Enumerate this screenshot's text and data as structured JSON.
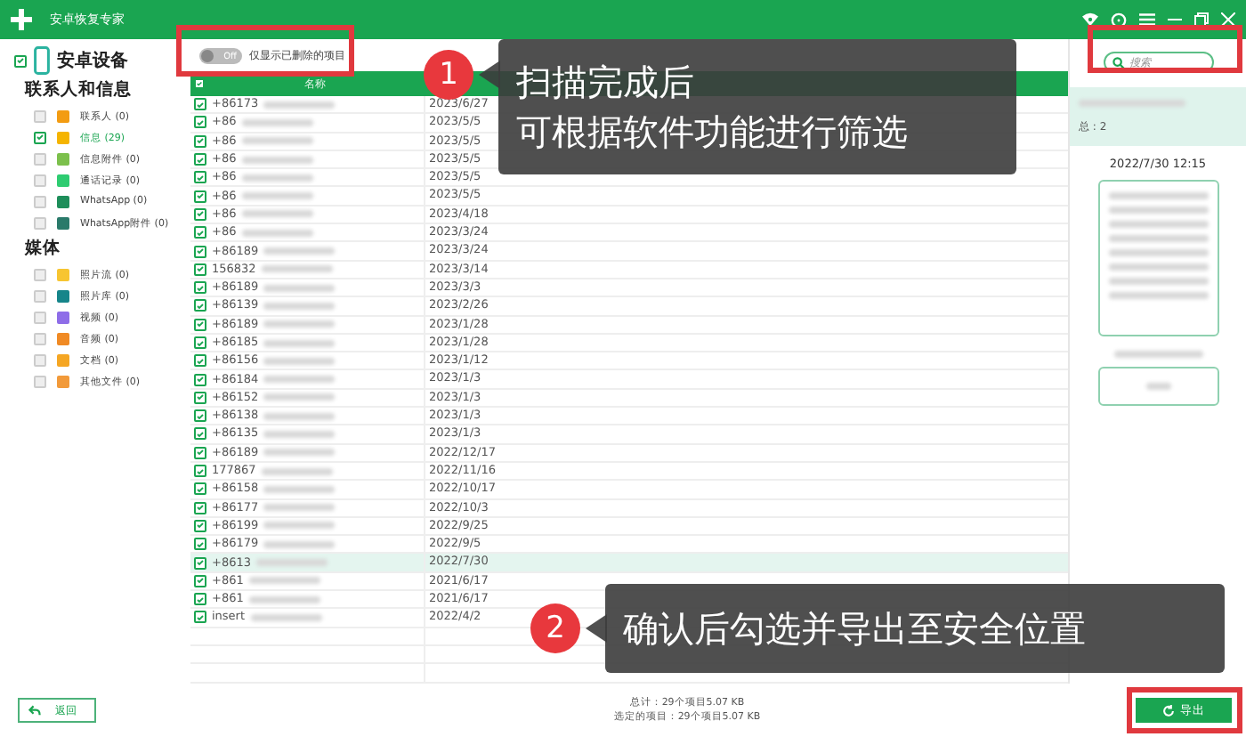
{
  "window": {
    "title": "安卓恢复专家"
  },
  "sidebar": {
    "device": {
      "label": "安卓设备",
      "checked": true
    },
    "groups": [
      {
        "title": "联系人和信息",
        "items": [
          {
            "label": "联系人 (0)",
            "checked": false,
            "color": "#f39c12"
          },
          {
            "label": "信息 (29)",
            "checked": true,
            "color": "#f5b400"
          },
          {
            "label": "信息附件 (0)",
            "checked": false,
            "color": "#7cc04c"
          },
          {
            "label": "通话记录 (0)",
            "checked": false,
            "color": "#2ecc71"
          },
          {
            "label": "WhatsApp (0)",
            "checked": false,
            "color": "#1e8e5a"
          },
          {
            "label": "WhatsApp附件 (0)",
            "checked": false,
            "color": "#2a7a6a"
          }
        ]
      },
      {
        "title": "媒体",
        "items": [
          {
            "label": "照片流 (0)",
            "checked": false,
            "color": "#f7c531"
          },
          {
            "label": "照片库 (0)",
            "checked": false,
            "color": "#16858a"
          },
          {
            "label": "视频 (0)",
            "checked": false,
            "color": "#8e6de8"
          },
          {
            "label": "音频 (0)",
            "checked": false,
            "color": "#f08a24"
          },
          {
            "label": "文档 (0)",
            "checked": false,
            "color": "#f5a623"
          },
          {
            "label": "其他文件 (0)",
            "checked": false,
            "color": "#f29a3a"
          }
        ]
      }
    ]
  },
  "filter": {
    "switch_text": "Off",
    "on": false,
    "label": "仅显示已删除的项目"
  },
  "table": {
    "all_checked": true,
    "columns": [
      "名称"
    ],
    "rows": [
      {
        "name": "+86173",
        "date": "2023/6/27",
        "checked": true,
        "selected": false
      },
      {
        "name": "+86",
        "date": "2023/5/5",
        "checked": true,
        "selected": false
      },
      {
        "name": "+86",
        "date": "2023/5/5",
        "checked": true,
        "selected": false
      },
      {
        "name": "+86",
        "date": "2023/5/5",
        "checked": true,
        "selected": false
      },
      {
        "name": "+86",
        "date": "2023/5/5",
        "checked": true,
        "selected": false
      },
      {
        "name": "+86",
        "date": "2023/5/5",
        "checked": true,
        "selected": false
      },
      {
        "name": "+86",
        "date": "2023/4/18",
        "checked": true,
        "selected": false
      },
      {
        "name": "+86",
        "date": "2023/3/24",
        "checked": true,
        "selected": false
      },
      {
        "name": "+86189",
        "date": "2023/3/24",
        "checked": true,
        "selected": false
      },
      {
        "name": "156832",
        "date": "2023/3/14",
        "checked": true,
        "selected": false
      },
      {
        "name": "+86189",
        "date": "2023/3/3",
        "checked": true,
        "selected": false
      },
      {
        "name": "+86139",
        "date": "2023/2/26",
        "checked": true,
        "selected": false
      },
      {
        "name": "+86189",
        "date": "2023/1/28",
        "checked": true,
        "selected": false
      },
      {
        "name": "+86185",
        "date": "2023/1/28",
        "checked": true,
        "selected": false
      },
      {
        "name": "+86156",
        "date": "2023/1/12",
        "checked": true,
        "selected": false
      },
      {
        "name": "+86184",
        "date": "2023/1/3",
        "checked": true,
        "selected": false
      },
      {
        "name": "+86152",
        "date": "2023/1/3",
        "checked": true,
        "selected": false
      },
      {
        "name": "+86138",
        "date": "2023/1/3",
        "checked": true,
        "selected": false
      },
      {
        "name": "+86135",
        "date": "2023/1/3",
        "checked": true,
        "selected": false
      },
      {
        "name": "+86189",
        "date": "2022/12/17",
        "checked": true,
        "selected": false
      },
      {
        "name": "177867",
        "date": "2022/11/16",
        "checked": true,
        "selected": false
      },
      {
        "name": "+86158",
        "date": "2022/10/17",
        "checked": true,
        "selected": false
      },
      {
        "name": "+86177",
        "date": "2022/10/3",
        "checked": true,
        "selected": false
      },
      {
        "name": "+86199",
        "date": "2022/9/25",
        "checked": true,
        "selected": false
      },
      {
        "name": "+86179",
        "date": "2022/9/5",
        "checked": true,
        "selected": false
      },
      {
        "name": "+8613",
        "date": "2022/7/30",
        "checked": true,
        "selected": true
      },
      {
        "name": "+861",
        "date": "2021/6/17",
        "checked": true,
        "selected": false
      },
      {
        "name": "+861",
        "date": "2021/6/17",
        "checked": true,
        "selected": false
      },
      {
        "name": "insert",
        "date": "2022/4/2",
        "checked": true,
        "selected": false
      }
    ]
  },
  "preview": {
    "search_placeholder": "搜索",
    "total": "总 : 2",
    "time": "2022/7/30 12:15"
  },
  "footer": {
    "back": "返回",
    "total": "总计：29个项目5.07 KB",
    "selected": "选定的项目：29个项目5.07 KB",
    "export": "导出"
  },
  "callouts": [
    {
      "number": "1",
      "lines": [
        "扫描完成后",
        "可根据软件功能进行筛选"
      ]
    },
    {
      "number": "2",
      "lines": [
        "确认后勾选并导出至安全位置"
      ]
    }
  ]
}
